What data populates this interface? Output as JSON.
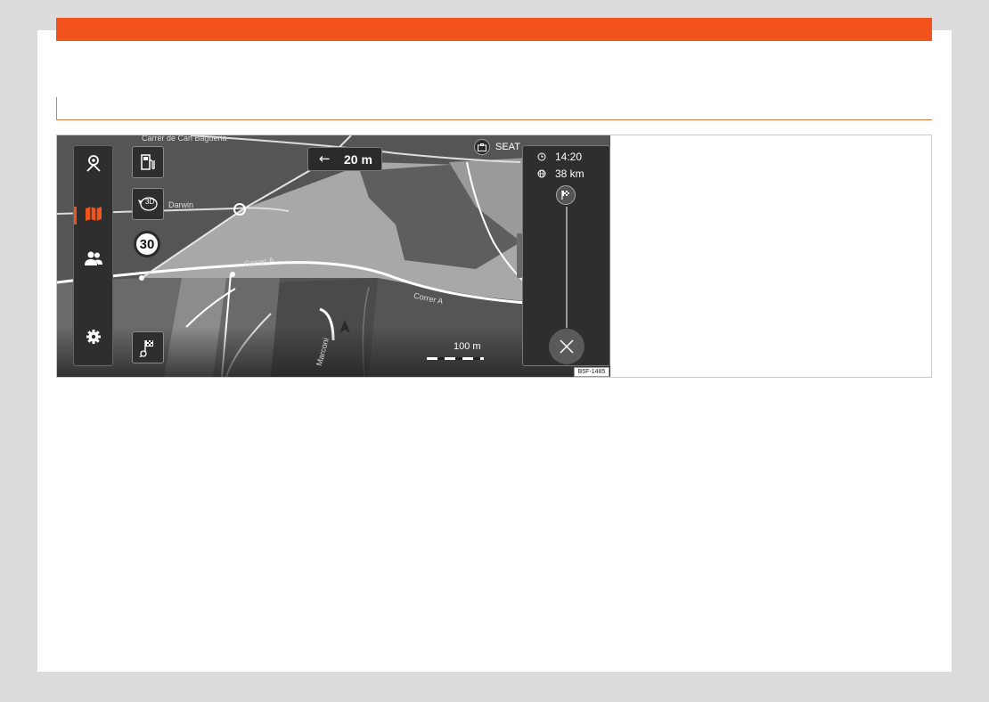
{
  "colors": {
    "accent": "#f2531c",
    "map_road": "#a6a6a6",
    "map_dark": "#545454",
    "panel": "#2e2e2e"
  },
  "map": {
    "streets": {
      "top": "Carrer de Can Bagueria",
      "darwin": "Darwin",
      "main_left": "Correr A",
      "main_right": "Correr A",
      "bottom": "Marconi"
    },
    "poi_label": "SEAT",
    "poi_icon": "briefcase-icon",
    "turn": {
      "arrow": "←",
      "distance": "20 m"
    },
    "speed_limit": "30",
    "scale_label": "100 m",
    "view_mode_label": "3D"
  },
  "left_menu": {
    "items": [
      {
        "icon": "navigation-icon"
      },
      {
        "icon": "map-icon",
        "active": true
      },
      {
        "icon": "people-icon"
      },
      {
        "icon": "gear-icon"
      }
    ]
  },
  "route_panel": {
    "arrival_time": "14:20",
    "distance": "38 km",
    "time_icon": "clock-icon",
    "distance_icon": "globe-icon"
  },
  "figure_code": "B5F-1485"
}
